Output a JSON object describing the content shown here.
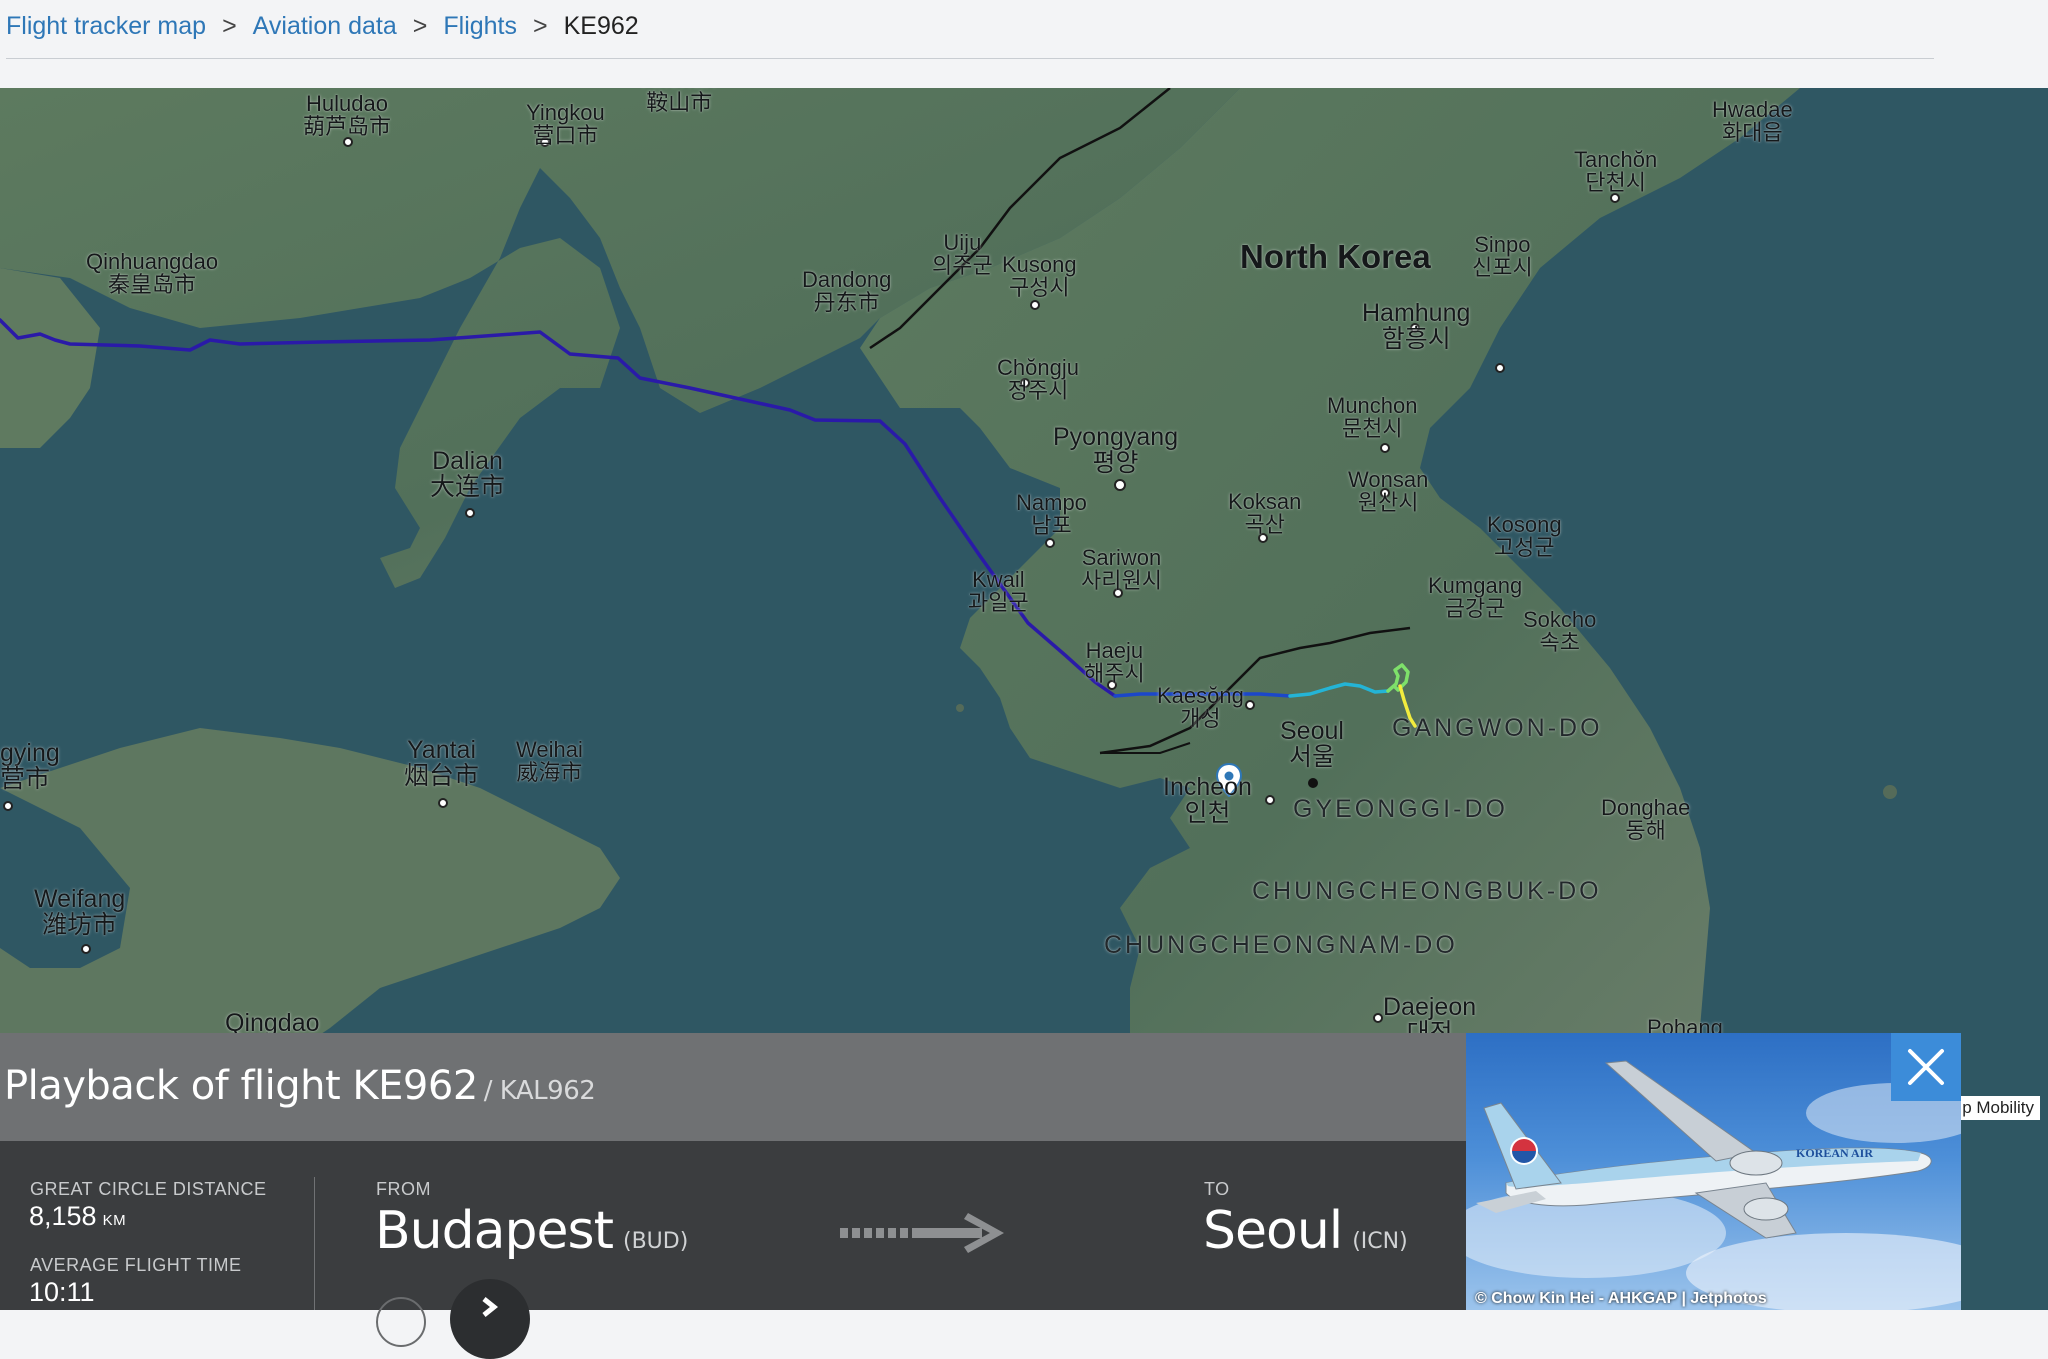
{
  "breadcrumb": {
    "items": [
      "Flight tracker map",
      "Aviation data",
      "Flights"
    ],
    "current": "KE962",
    "separator": ">"
  },
  "map": {
    "labels": {
      "huludao": "Huludao\n葫芦岛市",
      "yingkou": "Yingkou\n营口市",
      "anshan": "Anshan\n鞍山市",
      "hwadae": "Hwadae\n화대읍",
      "tanchon": "Tanchŏn\n단천시",
      "qinhuangdao": "Qinhuangdao\n秦皇岛市",
      "uiju": "Uiju\n의주군",
      "kusong": "Kusong\n구성시",
      "dandong": "Dandong\n丹东市",
      "north_korea": "North Korea",
      "sinpo": "Sinpo\n신포시",
      "hamhung": "Hamhung\n함흥시",
      "chongju": "Chŏngju\n정주시",
      "munchon": "Munchon\n문천시",
      "pyongyang": "Pyongyang\n평양",
      "dalian": "Dalian\n大连市",
      "nampo": "Nampo\n남포",
      "koksan": "Koksan\n곡산",
      "wonsan": "Wonsan\n원산시",
      "kosong": "Kosong\n고성군",
      "sariwon": "Sariwon\n사리원시",
      "kwail": "Kwail\n과일군",
      "kumgang": "Kumgang\n금강군",
      "sokcho": "Sokcho\n속초",
      "haeju": "Haeju\n해주시",
      "kaesong": "Kaesŏng\n개성",
      "seoul": "Seoul\n서울",
      "gangwon": "GANGWON-DO",
      "yingkou_left": "gying\n营市",
      "yantai": "Yantai\n烟台市",
      "weihai": "Weihai\n威海市",
      "incheon": "Incheon\n인천",
      "gyeonggi": "GYEONGGI-DO",
      "donghae": "Donghae\n동해",
      "weifang": "Weifang\n潍坊市",
      "chungbuk": "CHUNGCHEONGBUK-DO",
      "chungnam": "CHUNGCHEONGNAM-DO",
      "daejeon": "Daejeon\n대전",
      "qingdao": "Qingdao",
      "pohang": "Pohang"
    },
    "attribution": "p Mobility",
    "route_colors": [
      "#2a1aa8",
      "#1c47c9",
      "#24b4d6",
      "#7ee06a",
      "#f2ec3e"
    ],
    "destination_marker": "location-pin-icon"
  },
  "panel": {
    "title": "Playback of flight KE962",
    "subtitle": "/ KAL962",
    "great_circle_label": "GREAT CIRCLE DISTANCE",
    "great_circle_value": "8,158",
    "great_circle_unit": "KM",
    "avg_time_label": "AVERAGE FLIGHT TIME",
    "avg_time_value": "10:11",
    "from_label": "FROM",
    "from_city": "Budapest",
    "from_code": "(BUD)",
    "to_label": "TO",
    "to_city": "Seoul",
    "to_code": "(ICN)"
  },
  "photo": {
    "credit": "© Chow Kin Hei - AHKGAP | Jetphotos",
    "close_icon": "close-icon",
    "airline_text": "KOREAN AIR"
  }
}
